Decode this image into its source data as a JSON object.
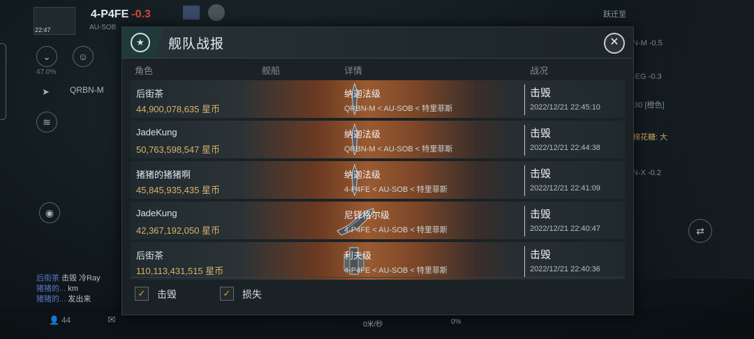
{
  "hud": {
    "system_name": "4-P4FE",
    "system_sec": "-0.3",
    "system_sub": "AU-SOB",
    "clock": "22:47",
    "destination": "QRBN-M",
    "percent": "47.0%",
    "speed": "0米/秒",
    "speed_pct": "0%",
    "player_count": "44",
    "right_labels": [
      "跃迁至",
      "N-M -0.5",
      "-EG -0.3",
      "130 [橙色]",
      "棉花糖: 大",
      "N-X -0.2"
    ],
    "chat": [
      {
        "prefix": "后街茶",
        "text": "击毁 冷Ray"
      },
      {
        "prefix": "猪猪的...",
        "text": "km"
      },
      {
        "prefix": "猪猪的...",
        "text": "发出来"
      }
    ]
  },
  "dialog": {
    "title": "舰队战报",
    "columns": {
      "role": "角色",
      "ship": "舰船",
      "detail": "详情",
      "status": "战况"
    },
    "rows": [
      {
        "name": "后街茶",
        "money": "44,900,078,635 星币",
        "ship_class": "纳迦法级",
        "route": "QRBN-M < AU-SOB < 特里菲斯",
        "status": "击毁",
        "time": "2022/12/21   22:45:10"
      },
      {
        "name": "JadeKung",
        "money": "50,763,598,547 星币",
        "ship_class": "纳迦法级",
        "route": "QRBN-M < AU-SOB < 特里菲斯",
        "status": "击毁",
        "time": "2022/12/21   22:44:38"
      },
      {
        "name": "猪猪的猪猪啊",
        "money": "45,845,935,435 星币",
        "ship_class": "纳迦法级",
        "route": "4-P4FE < AU-SOB < 特里菲斯",
        "status": "击毁",
        "time": "2022/12/21   22:41:09"
      },
      {
        "name": "JadeKung",
        "money": "42,367,192,050 星币",
        "ship_class": "尼铎格尔级",
        "route": "4-P4FE < AU-SOB < 特里菲斯",
        "status": "击毁",
        "time": "2022/12/21   22:40:47"
      },
      {
        "name": "后街茶",
        "money": "110,113,431,515 星币",
        "ship_class": "利夫级",
        "route": "4-P4FE < AU-SOB < 特里菲斯",
        "status": "击毁",
        "time": "2022/12/21   22:40:36"
      }
    ],
    "filters": [
      {
        "label": "击毁",
        "checked": true
      },
      {
        "label": "损失",
        "checked": true
      }
    ]
  },
  "colors": {
    "accent": "#e0a32e",
    "money": "#d9b26a",
    "sec_negative": "#e0463a"
  },
  "icons": [
    "fleet-star-icon",
    "close-icon",
    "checkmark-icon",
    "ship-icon"
  ]
}
